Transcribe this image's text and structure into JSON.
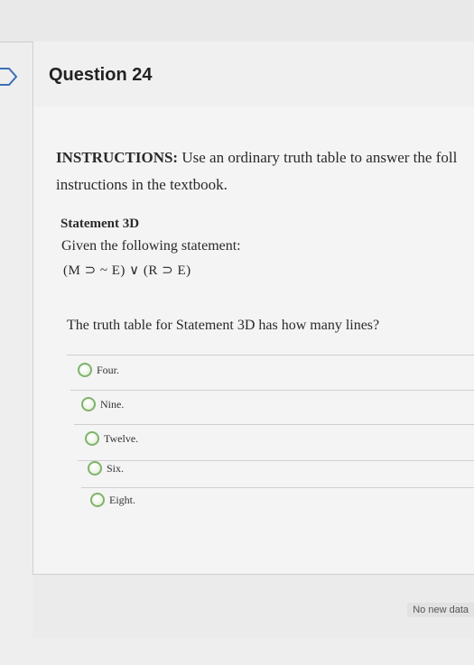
{
  "question": {
    "title": "Question 24"
  },
  "instructions": {
    "label": "INSTRUCTIONS:",
    "line1_rest": " Use an ordinary truth table to answer the foll",
    "line2": "instructions in the textbook."
  },
  "statement": {
    "title": "Statement 3D",
    "given": "Given the following statement:",
    "formula": "(M ⊃ ~ E) ∨ (R ⊃ E)"
  },
  "prompt": "The truth table for Statement 3D has how many lines?",
  "options": [
    {
      "label": "Four."
    },
    {
      "label": "Nine."
    },
    {
      "label": "Twelve."
    },
    {
      "label": "Six."
    },
    {
      "label": "Eight."
    }
  ],
  "status_text": "No new data",
  "colors": {
    "radio_border": "#7fb36a",
    "background": "#e9e9ea"
  }
}
